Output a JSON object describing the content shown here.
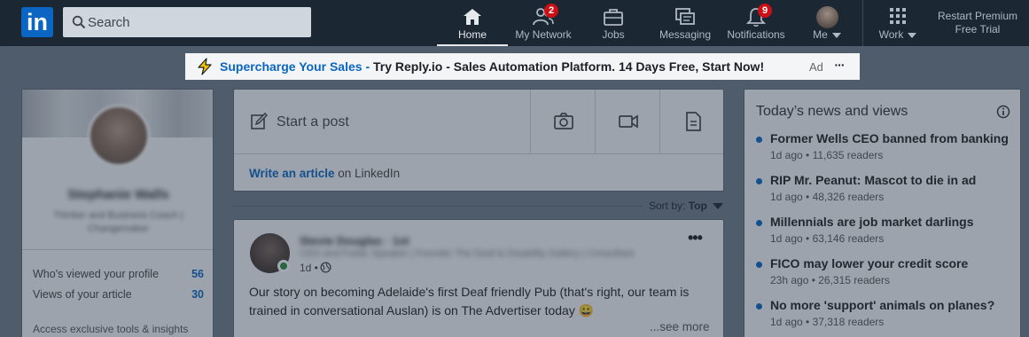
{
  "nav": {
    "logo": "in",
    "search_placeholder": "Search",
    "items": [
      {
        "label": "Home",
        "icon": "home-icon",
        "active": true
      },
      {
        "label": "My Network",
        "icon": "network-icon",
        "badge": "2"
      },
      {
        "label": "Jobs",
        "icon": "briefcase-icon"
      },
      {
        "label": "Messaging",
        "icon": "messaging-icon"
      },
      {
        "label": "Notifications",
        "icon": "bell-icon",
        "badge": "9"
      },
      {
        "label": "Me",
        "icon": "avatar"
      },
      {
        "label": "Work",
        "icon": "grid-icon"
      }
    ],
    "premium_line1": "Restart Premium",
    "premium_line2": "Free Trial"
  },
  "ad": {
    "link_text": "Supercharge Your Sales - ",
    "rest_text": "Try Reply.io - Sales Automation Platform. 14 Days Free, Start Now!",
    "tag": "Ad",
    "more": "···"
  },
  "profile": {
    "name": "Stephanie Walls",
    "headline": "Thinker and Business Coach | Changemaker",
    "stats": [
      {
        "label": "Who's viewed your profile",
        "value": "56"
      },
      {
        "label": "Views of your article",
        "value": "30"
      }
    ],
    "access": "Access exclusive tools & insights"
  },
  "share": {
    "start_post": "Start a post",
    "write_article": "Write an article",
    "on_linkedin": " on LinkedIn"
  },
  "sort": {
    "label": "Sort by: ",
    "value": "Top"
  },
  "post": {
    "author": "Stevie Douglas",
    "author_degree": " · 1st",
    "headline": "CEO and Public Speaker | Founder The Deaf & Disability Gallery | Consultant",
    "time": "1d •",
    "more": "•••",
    "body": "Our story on becoming Adelaide's first Deaf friendly Pub (that's right, our team is trained in conversational Auslan) is on The Advertiser today 😀",
    "see_more": "...see more"
  },
  "news": {
    "title": "Today’s news and views",
    "items": [
      {
        "headline": "Former Wells CEO banned from banking",
        "meta": "1d ago • 11,635 readers"
      },
      {
        "headline": "RIP Mr. Peanut: Mascot to die in ad",
        "meta": "1d ago • 48,326 readers"
      },
      {
        "headline": "Millennials are job market darlings",
        "meta": "1d ago • 63,146 readers"
      },
      {
        "headline": "FICO may lower your credit score",
        "meta": "23h ago • 26,315 readers"
      },
      {
        "headline": "No more 'support' animals on planes?",
        "meta": "1d ago • 37,318 readers"
      }
    ]
  },
  "colors": {
    "nav_bg": "#1b2733",
    "brand": "#0a66c2",
    "badge": "#cc1016",
    "overlay": "#233244"
  }
}
